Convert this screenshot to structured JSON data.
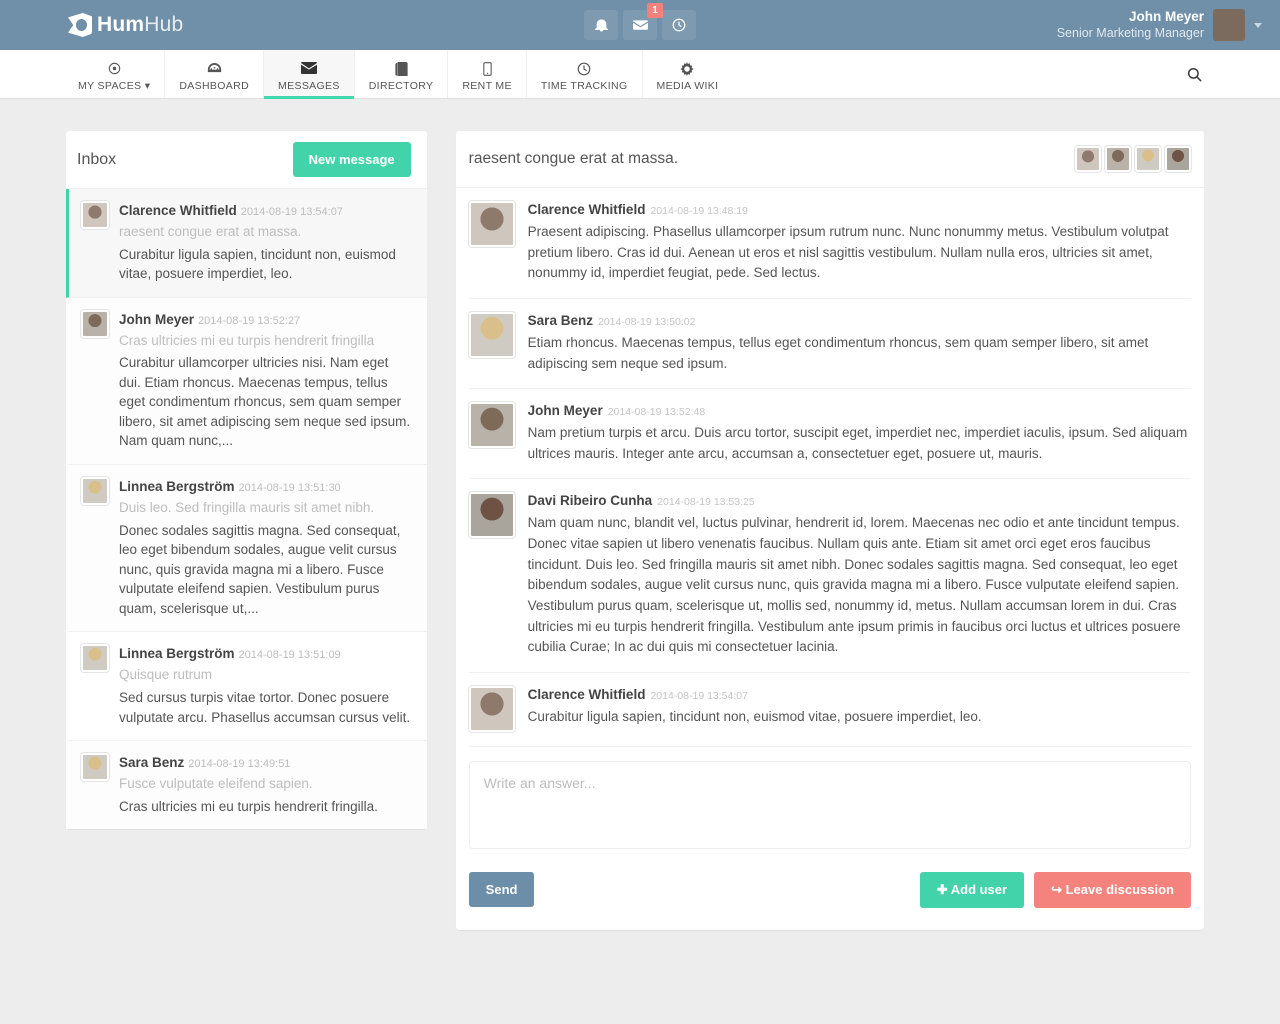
{
  "topbar": {
    "logo_c": "C",
    "logo_bold": "Hum",
    "logo_light": "Hub",
    "icons": [
      {
        "name": "notifications-icon",
        "glyph": "ὑ4"
      },
      {
        "name": "messages-icon",
        "glyph": "✉",
        "badge": "1"
      },
      {
        "name": "activity-icon",
        "glyph": "⏱"
      }
    ],
    "user_name": "John Meyer",
    "user_role": "Senior Marketing Manager"
  },
  "nav": {
    "items": [
      {
        "label": "MY SPACES",
        "icon": "target-icon",
        "glyph": "◉",
        "caret": true,
        "active": false
      },
      {
        "label": "DASHBOARD",
        "icon": "dashboard-icon",
        "glyph": "⚘",
        "active": false
      },
      {
        "label": "MESSAGES",
        "icon": "envelope-icon",
        "glyph": "✉",
        "active": true
      },
      {
        "label": "DIRECTORY",
        "icon": "book-icon",
        "glyph": "▤",
        "active": false
      },
      {
        "label": "RENT ME",
        "icon": "mobile-icon",
        "glyph": "▯",
        "active": false
      },
      {
        "label": "TIME TRACKING",
        "icon": "clock-icon",
        "glyph": "◴",
        "active": false
      },
      {
        "label": "MEDIA WIKI",
        "icon": "gear-icon",
        "glyph": "⚙",
        "active": false
      }
    ],
    "search_icon": "search-icon",
    "search_glyph": "⌕"
  },
  "inbox": {
    "title": "Inbox",
    "new_message_label": "New message",
    "items": [
      {
        "name": "Clarence Whitfield",
        "time": "2014-08-19 13:54:07",
        "subject": "raesent congue erat at massa.",
        "preview": "Curabitur ligula sapien, tincidunt non, euismod vitae, posuere imperdiet, leo.",
        "avatar": "a1",
        "state": "active"
      },
      {
        "name": "John Meyer",
        "time": "2014-08-19 13:52:27",
        "subject": "Cras ultricies mi eu turpis hendrerit fringilla",
        "preview": "Curabitur ullamcorper ultricies nisi. Nam eget dui. Etiam rhoncus. Maecenas tempus, tellus eget condimentum rhoncus, sem quam semper libero, sit amet adipiscing sem neque sed ipsum. Nam quam nunc,...",
        "avatar": "a2",
        "state": "unread"
      },
      {
        "name": "Linnea Bergström",
        "time": "2014-08-19 13:51:30",
        "subject": "Duis leo. Sed fringilla mauris sit amet nibh.",
        "preview": "Donec sodales sagittis magna. Sed consequat, leo eget bibendum sodales, augue velit cursus nunc, quis gravida magna mi a libero. Fusce vulputate eleifend sapien. Vestibulum purus quam, scelerisque ut,...",
        "avatar": "a3",
        "state": "unread"
      },
      {
        "name": "Linnea Bergström",
        "time": "2014-08-19 13:51:09",
        "subject": "Quisque rutrum",
        "preview": "Sed cursus turpis vitae tortor. Donec posuere vulputate arcu. Phasellus accumsan cursus velit.",
        "avatar": "a3",
        "state": "read"
      },
      {
        "name": "Sara Benz",
        "time": "2014-08-19 13:49:51",
        "subject": "Fusce vulputate eleifend sapien.",
        "preview": "Cras ultricies mi eu turpis hendrerit fringilla.",
        "avatar": "a3",
        "state": "unread"
      }
    ]
  },
  "conversation": {
    "title": "raesent congue erat at massa.",
    "participants": [
      {
        "name": "Clarence Whitfield",
        "avatar": "a1"
      },
      {
        "name": "John Meyer",
        "avatar": "a2"
      },
      {
        "name": "Sara Benz",
        "avatar": "a3"
      },
      {
        "name": "Davi Ribeiro Cunha",
        "avatar": "a4"
      }
    ],
    "messages": [
      {
        "name": "Clarence Whitfield",
        "time": "2014-08-19 13:48:19",
        "avatar": "a1",
        "text": "Praesent adipiscing. Phasellus ullamcorper ipsum rutrum nunc. Nunc nonummy metus. Vestibulum volutpat pretium libero. Cras id dui. Aenean ut eros et nisl sagittis vestibulum. Nullam nulla eros, ultricies sit amet, nonummy id, imperdiet feugiat, pede. Sed lectus."
      },
      {
        "name": "Sara Benz",
        "time": "2014-08-19 13:50:02",
        "avatar": "a3",
        "text": "Etiam rhoncus. Maecenas tempus, tellus eget condimentum rhoncus, sem quam semper libero, sit amet adipiscing sem neque sed ipsum."
      },
      {
        "name": "John Meyer",
        "time": "2014-08-19 13:52:48",
        "avatar": "a2",
        "text": "Nam pretium turpis et arcu. Duis arcu tortor, suscipit eget, imperdiet nec, imperdiet iaculis, ipsum. Sed aliquam ultrices mauris. Integer ante arcu, accumsan a, consectetuer eget, posuere ut, mauris."
      },
      {
        "name": "Davi Ribeiro Cunha",
        "time": "2014-08-19 13:53:25",
        "avatar": "a4",
        "text": "Nam quam nunc, blandit vel, luctus pulvinar, hendrerit id, lorem. Maecenas nec odio et ante tincidunt tempus. Donec vitae sapien ut libero venenatis faucibus. Nullam quis ante. Etiam sit amet orci eget eros faucibus tincidunt. Duis leo. Sed fringilla mauris sit amet nibh. Donec sodales sagittis magna. Sed consequat, leo eget bibendum sodales, augue velit cursus nunc, quis gravida magna mi a libero. Fusce vulputate eleifend sapien. Vestibulum purus quam, scelerisque ut, mollis sed, nonummy id, metus. Nullam accumsan lorem in dui. Cras ultricies mi eu turpis hendrerit fringilla. Vestibulum ante ipsum primis in faucibus orci luctus et ultrices posuere cubilia Curae; In ac dui quis mi consectetuer lacinia."
      },
      {
        "name": "Clarence Whitfield",
        "time": "2014-08-19 13:54:07",
        "avatar": "a1",
        "text": "Curabitur ligula sapien, tincidunt non, euismod vitae, posuere imperdiet, leo."
      }
    ],
    "answer_placeholder": "Write an answer...",
    "answer_value": "",
    "send_label": "Send",
    "add_user_label": "Add user",
    "add_user_glyph": "✚",
    "leave_label": "Leave discussion",
    "leave_glyph": "↪"
  },
  "colors": {
    "header": "#708fa8",
    "accent_green": "#42d3ab",
    "danger_red": "#f4827d",
    "send_blue": "#6c8ea8",
    "page_bg": "#ededed"
  }
}
